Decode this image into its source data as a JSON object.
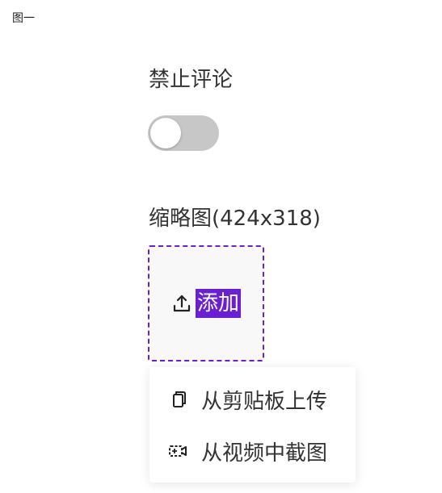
{
  "figure_caption": "图一",
  "comment_setting": {
    "label": "禁止评论",
    "enabled": false
  },
  "thumbnail": {
    "label": "缩略图(424x318)",
    "add_label": "添加",
    "upload_icon": "upload-icon"
  },
  "menu": {
    "items": [
      {
        "label": "从剪贴板上传",
        "icon": "clipboard-icon"
      },
      {
        "label": "从视频中截图",
        "icon": "video-capture-icon"
      }
    ]
  },
  "colors": {
    "accent": "#6a1fd0",
    "toggle_off": "#c7c7c7"
  }
}
